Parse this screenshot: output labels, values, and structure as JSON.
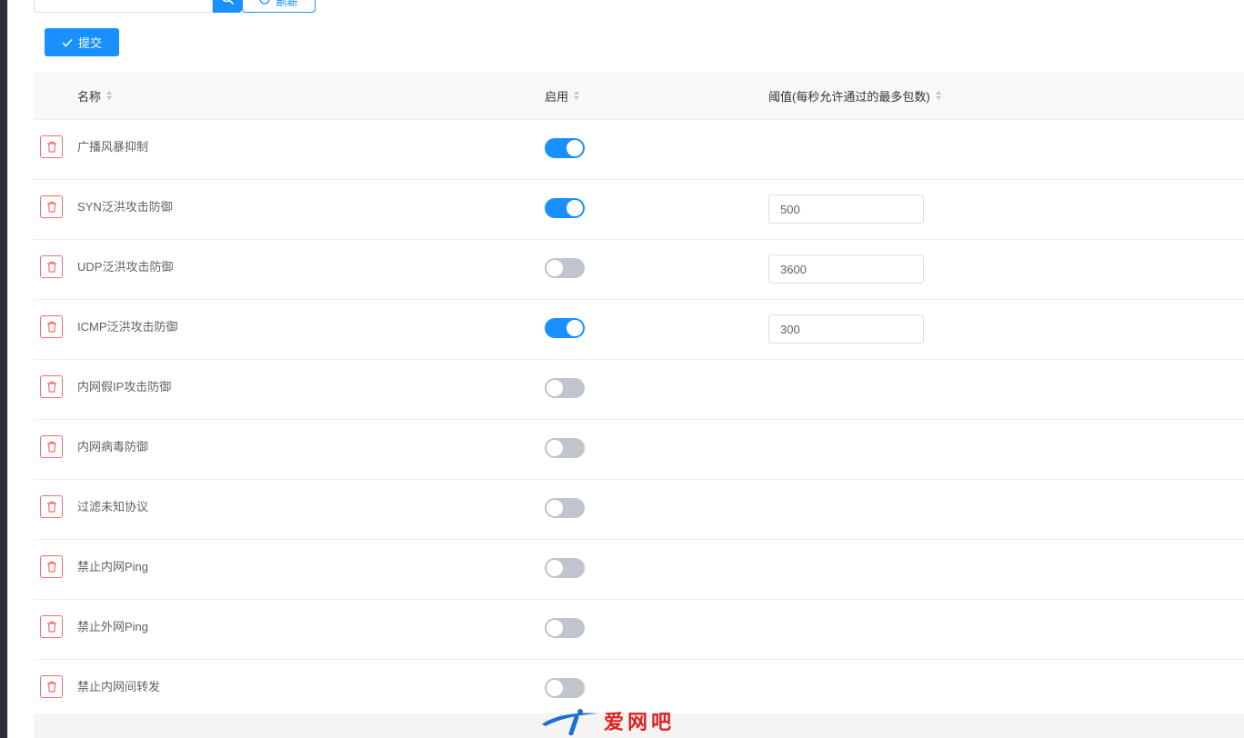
{
  "toolbar": {
    "search_placeholder": "",
    "refresh_label": "刷新",
    "submit_label": "提交"
  },
  "table": {
    "columns": [
      {
        "label": "名称"
      },
      {
        "label": "启用"
      },
      {
        "label": "阈值(每秒允许通过的最多包数)"
      }
    ],
    "rows": [
      {
        "name": "广播风暴抑制",
        "enabled": true,
        "threshold": ""
      },
      {
        "name": "SYN泛洪攻击防御",
        "enabled": true,
        "threshold": "500"
      },
      {
        "name": "UDP泛洪攻击防御",
        "enabled": false,
        "threshold": "3600"
      },
      {
        "name": "ICMP泛洪攻击防御",
        "enabled": true,
        "threshold": "300"
      },
      {
        "name": "内网假IP攻击防御",
        "enabled": false,
        "threshold": ""
      },
      {
        "name": "内网病毒防御",
        "enabled": false,
        "threshold": ""
      },
      {
        "name": "过滤未知协议",
        "enabled": false,
        "threshold": ""
      },
      {
        "name": "禁止内网Ping",
        "enabled": false,
        "threshold": ""
      },
      {
        "name": "禁止外网Ping",
        "enabled": false,
        "threshold": ""
      },
      {
        "name": "禁止内网间转发",
        "enabled": false,
        "threshold": ""
      }
    ]
  },
  "watermark": {
    "text": "爱网吧"
  },
  "colors": {
    "primary": "#1890ff",
    "danger": "#f56c6c",
    "switch_off": "#c0c4cc"
  }
}
